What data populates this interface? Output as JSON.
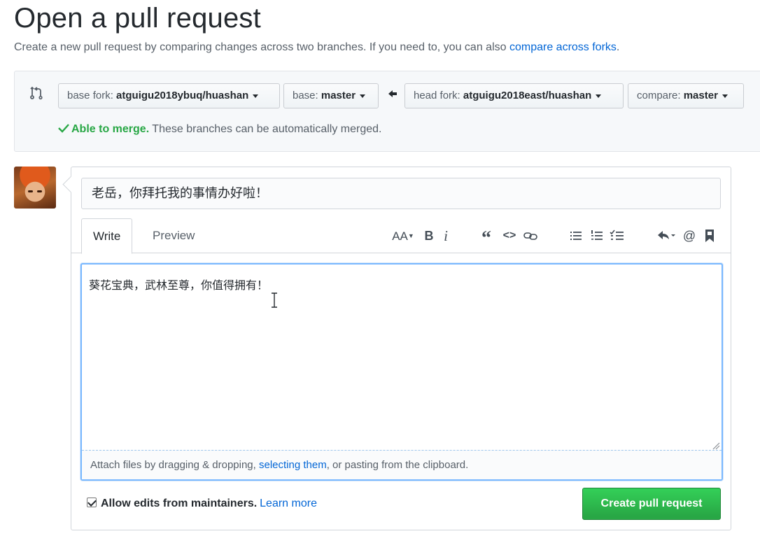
{
  "header": {
    "title": "Open a pull request",
    "subtitle": "Create a new pull request by comparing changes across two branches. If you need to, you can also",
    "subtitle_link": "compare across forks",
    "subtitle_end": "."
  },
  "range": {
    "base_fork_label": "base fork:",
    "base_fork_value": "atguigu2018ybuq/huashan",
    "base_label": "base:",
    "base_value": "master",
    "head_fork_label": "head fork:",
    "head_fork_value": "atguigu2018east/huashan",
    "compare_label": "compare:",
    "compare_value": "master",
    "merge_ok": "Able to merge.",
    "merge_text": "These branches can be automatically merged.",
    "merge_color": "#28a745"
  },
  "form": {
    "title_value": "老岳，你拜托我的事情办好啦！",
    "tabs": [
      {
        "label": "Write"
      },
      {
        "label": "Preview"
      }
    ],
    "toolbar_icons": [
      "header-icon",
      "bold-icon",
      "italic-icon",
      "quote-icon",
      "code-icon",
      "link-icon",
      "unordered-list-icon",
      "ordered-list-icon",
      "task-list-icon",
      "reply-icon",
      "mention-icon",
      "reference-icon"
    ],
    "header_tool": "AA",
    "bold_tool": "B",
    "italic_tool": "i",
    "quote_tool": "“",
    "code_tool": "<>",
    "mention_tool": "@",
    "body_value": "葵花宝典，武林至尊，你值得拥有！",
    "attach_pre": "Attach files by dragging & dropping, ",
    "attach_link": "selecting them",
    "attach_post": ", or pasting from the clipboard.",
    "allow_edits_label": "Allow edits from maintainers.",
    "learn_more": "Learn more",
    "create_button": "Create pull request",
    "button_color": "#28a745"
  }
}
